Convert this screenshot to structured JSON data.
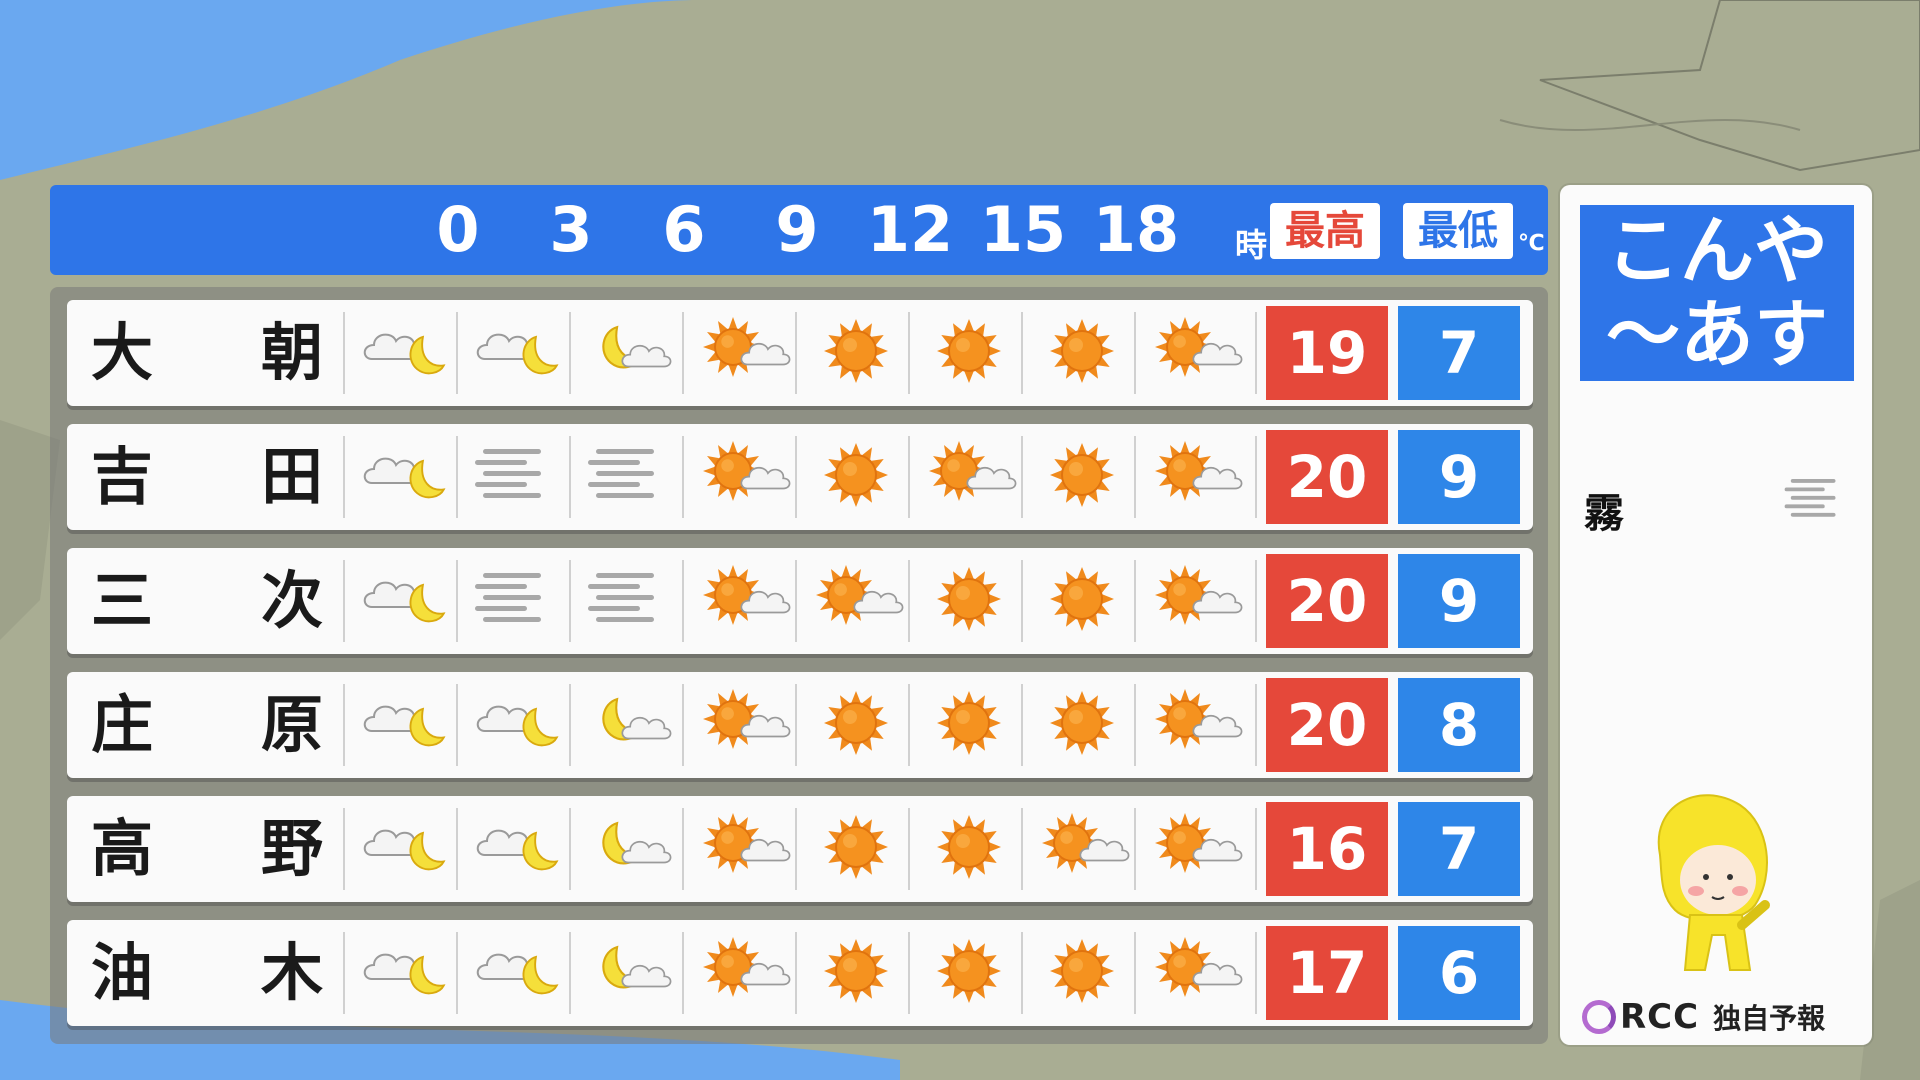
{
  "header": {
    "hours": [
      "0",
      "3",
      "6",
      "9",
      "12",
      "15",
      "18"
    ],
    "hour_unit": "時",
    "high_label": "最高",
    "low_label": "最低",
    "temp_unit": "℃"
  },
  "rows": [
    {
      "city1": "大",
      "city2": "朝",
      "icons": [
        "cloud-moon-icon",
        "cloud-moon-icon",
        "moon-cloud-icon",
        "sun-cloud-icon",
        "sun-icon",
        "sun-icon",
        "sun-icon",
        "sun-cloud-icon"
      ],
      "high": "19",
      "low": "7"
    },
    {
      "city1": "吉",
      "city2": "田",
      "icons": [
        "cloud-moon-icon",
        "fog-icon",
        "fog-icon",
        "sun-cloud-icon",
        "sun-icon",
        "sun-cloud-icon",
        "sun-icon",
        "sun-cloud-icon"
      ],
      "high": "20",
      "low": "9"
    },
    {
      "city1": "三",
      "city2": "次",
      "icons": [
        "cloud-moon-icon",
        "fog-icon",
        "fog-icon",
        "sun-cloud-icon",
        "sun-cloud-icon",
        "sun-icon",
        "sun-icon",
        "sun-cloud-icon"
      ],
      "high": "20",
      "low": "9"
    },
    {
      "city1": "庄",
      "city2": "原",
      "icons": [
        "cloud-moon-icon",
        "cloud-moon-icon",
        "moon-cloud-icon",
        "sun-cloud-icon",
        "sun-icon",
        "sun-icon",
        "sun-icon",
        "sun-cloud-icon"
      ],
      "high": "20",
      "low": "8"
    },
    {
      "city1": "高",
      "city2": "野",
      "icons": [
        "cloud-moon-icon",
        "cloud-moon-icon",
        "moon-cloud-icon",
        "sun-cloud-icon",
        "sun-icon",
        "sun-icon",
        "sun-cloud-icon",
        "sun-cloud-icon"
      ],
      "high": "16",
      "low": "7"
    },
    {
      "city1": "油",
      "city2": "木",
      "icons": [
        "cloud-moon-icon",
        "cloud-moon-icon",
        "moon-cloud-icon",
        "sun-cloud-icon",
        "sun-icon",
        "sun-icon",
        "sun-icon",
        "sun-cloud-icon"
      ],
      "high": "17",
      "low": "6"
    }
  ],
  "side": {
    "title_line1": "こんや",
    "title_line2": "～あす",
    "legend_label": "霧",
    "legend_icon": "fog-icon",
    "logo_text": "RCC",
    "logo_sub": "独自予報"
  },
  "colors": {
    "header_blue": "#2e75e8",
    "high_red": "#e5483a",
    "low_blue": "#2e86e8",
    "sea": "#6aa8f0",
    "land": "#a9ad93"
  }
}
